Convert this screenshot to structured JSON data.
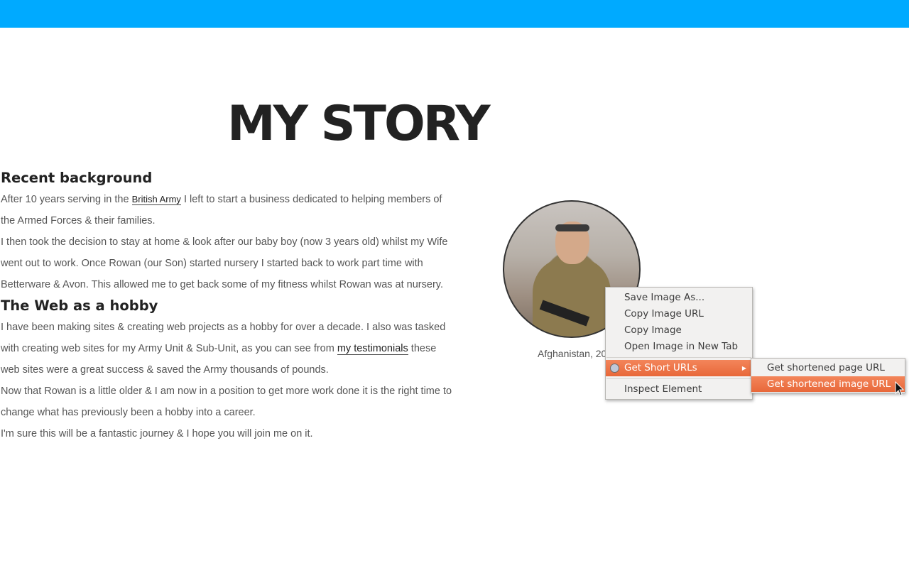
{
  "page": {
    "title": "MY STORY",
    "accent_color": "#00aaff"
  },
  "sections": [
    {
      "heading": "Recent background",
      "paragraphs": [
        {
          "before": "After 10 years serving in the ",
          "link": "British Army",
          "after": " I left to start a business dedicated to helping members of the Armed Forces & their families."
        },
        {
          "text": "I then took the decision to stay at home & look after our baby boy (now 3 years old) whilst my Wife went out to work. Once Rowan (our Son) started nursery I started back to work part time with Betterware & Avon. This allowed me to get back some of my fitness whilst Rowan was at nursery."
        }
      ]
    },
    {
      "heading": "The Web as a hobby",
      "paragraphs": [
        {
          "before": "I have been making sites & creating web projects as a hobby for over a decade. I also was tasked with creating web sites for my Army Unit & Sub-Unit, as you can see from ",
          "link": "my testimonials",
          "after": " these web sites were a great success & saved the Army thousands of pounds."
        },
        {
          "text": "Now that Rowan is a little older & I am now in a position to get more work done it is the right time to change what has previously been a hobby into a career."
        },
        {
          "text": "I'm sure this will be a fantastic journey & I hope you will join me on it."
        }
      ]
    }
  ],
  "photo": {
    "caption": "Afghanistan, 20"
  },
  "context_menu": {
    "items": [
      {
        "label": "Save Image As..."
      },
      {
        "label": "Copy Image URL"
      },
      {
        "label": "Copy Image"
      },
      {
        "label": "Open Image in New Tab"
      },
      {
        "label": "Get Short URLs",
        "icon": "addon-icon",
        "has_submenu": true,
        "highlighted": true
      },
      {
        "label": "Inspect Element"
      }
    ],
    "submenu": [
      {
        "label": "Get shortened page URL"
      },
      {
        "label": "Get shortened image URL",
        "highlighted": true
      }
    ],
    "highlight_color": "#e8683a"
  }
}
